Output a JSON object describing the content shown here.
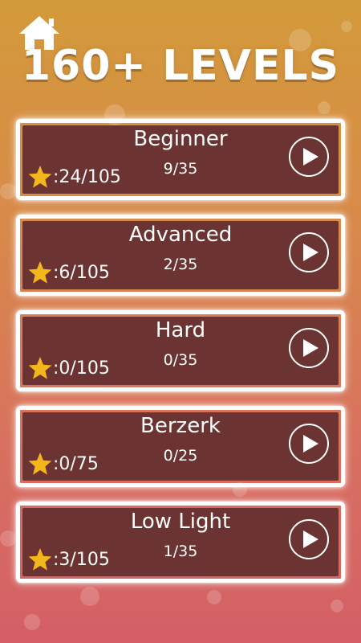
{
  "header": {
    "home_icon": "home-icon",
    "title": "160+ LEVELS"
  },
  "levels": [
    {
      "name": "Beginner",
      "progress": "9/35",
      "stars": ":24/105"
    },
    {
      "name": "Advanced",
      "progress": "2/35",
      "stars": ":6/105"
    },
    {
      "name": "Hard",
      "progress": "0/35",
      "stars": ":0/105"
    },
    {
      "name": "Berzerk",
      "progress": "0/25",
      "stars": ":0/75"
    },
    {
      "name": "Low Light",
      "progress": "1/35",
      "stars": ":3/105"
    }
  ],
  "colors": {
    "card_bg": "#6b3432",
    "star": "#f4b71b",
    "text": "#ffffff"
  },
  "icons": {
    "star": "star-icon",
    "play": "play-icon"
  }
}
